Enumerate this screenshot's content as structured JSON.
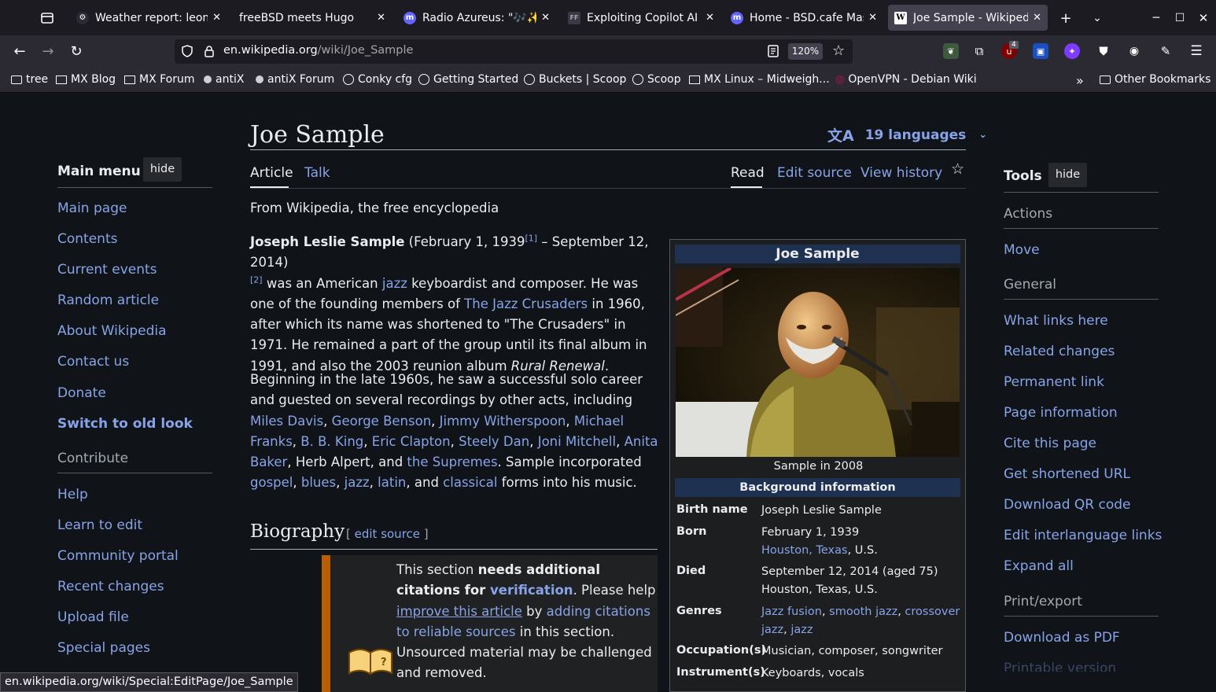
{
  "browser": {
    "tabs": [
      {
        "title": "Weather report: leonsb",
        "active": false
      },
      {
        "title": "freeBSD meets Hugo",
        "active": false
      },
      {
        "title": "Radio Azureus: \"🎶✨❤️",
        "active": false
      },
      {
        "title": "Exploiting Copilot AI fo",
        "active": false
      },
      {
        "title": "Home - BSD.cafe Masto",
        "active": false
      },
      {
        "title": "Joe Sample - Wikipedia",
        "active": true
      }
    ],
    "url_host": "en.wikipedia.org",
    "url_path": "/wiki/Joe_Sample",
    "zoom": "120%",
    "extension_badge": "4",
    "bookmarks": [
      "tree",
      "MX Blog",
      "MX Forum",
      "antiX",
      "antiX Forum",
      "Conky cfg",
      "Getting Started",
      "Buckets | Scoop",
      "Scoop",
      "MX Linux – Midweigh...",
      "OpenVPN - Debian Wiki"
    ],
    "other_bookmarks": "Other Bookmarks",
    "status_url": "en.wikipedia.org/wiki/Special:EditPage/Joe_Sample"
  },
  "sidebar": {
    "heading": "Main menu",
    "hide": "hide",
    "nav": [
      "Main page",
      "Contents",
      "Current events",
      "Random article",
      "About Wikipedia",
      "Contact us",
      "Donate",
      "Switch to old look"
    ],
    "contribute_heading": "Contribute",
    "contribute": [
      "Help",
      "Learn to edit",
      "Community portal",
      "Recent changes",
      "Upload file",
      "Special pages"
    ]
  },
  "article": {
    "title": "Joe Sample",
    "languages": "19 languages",
    "tab_article": "Article",
    "tab_talk": "Talk",
    "tab_read": "Read",
    "tab_edit": "Edit source",
    "tab_history": "View history",
    "from": "From Wikipedia, the free encyclopedia",
    "bio_heading": "Biography",
    "bio_edit": "edit source",
    "notice": {
      "t1": "This section ",
      "bold": "needs additional citations for ",
      "verification": "verification",
      "t2": ". Please help ",
      "improve": "improve this article",
      "t3": " by ",
      "adding": "adding citations to reliable sources",
      "t4": " in this section. Unsourced material may be challenged and removed."
    }
  },
  "infobox": {
    "title": "Joe Sample",
    "caption": "Sample in 2008",
    "subheader": "Background information",
    "rows": [
      {
        "label": "Birth name",
        "value": "Joseph Leslie Sample"
      },
      {
        "label": "Born",
        "value": "February 1, 1939"
      },
      {
        "label": "Died",
        "value": "September 12, 2014 (aged 75)"
      },
      {
        "label": "Genres",
        "value": ""
      },
      {
        "label": "Occupation(s)",
        "value": "Musician, composer, songwriter"
      },
      {
        "label": "Instrument(s)",
        "value": "Keyboards, vocals"
      }
    ],
    "born_place": [
      "Houston, Texas",
      ", U.S."
    ],
    "died_place": "Houston, Texas, U.S.",
    "genres": [
      "Jazz fusion",
      "smooth jazz",
      "crossover jazz",
      "jazz"
    ]
  },
  "tools": {
    "heading": "Tools",
    "hide": "hide",
    "actions_heading": "Actions",
    "actions": [
      "Move"
    ],
    "general_heading": "General",
    "general": [
      "What links here",
      "Related changes",
      "Permanent link",
      "Page information",
      "Cite this page",
      "Get shortened URL",
      "Download QR code",
      "Edit interlanguage links",
      "Expand all"
    ],
    "print_heading": "Print/export",
    "print": [
      "Download as PDF",
      "Printable version"
    ]
  },
  "colors": {
    "link": "#88a3e8",
    "background": "#101418",
    "infobox_header": "#1e3150",
    "ambox_border": "#b85e00"
  }
}
